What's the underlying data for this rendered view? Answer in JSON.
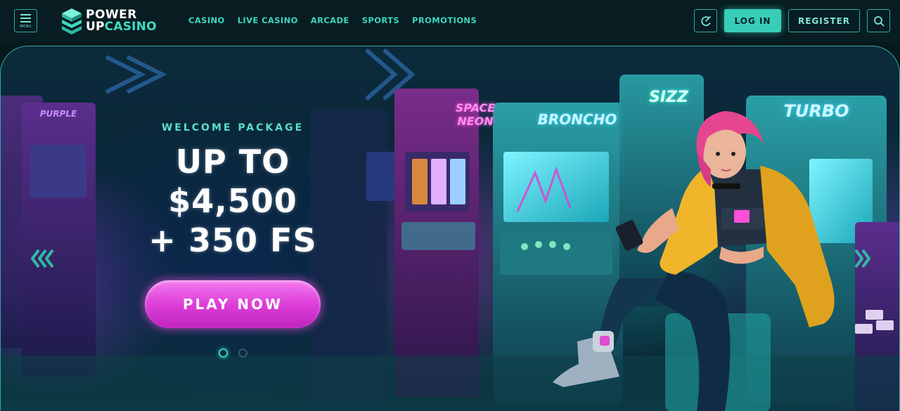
{
  "header": {
    "menu_label": "MENU",
    "logo": {
      "line1": "POWER",
      "line2a": "UP",
      "line2b": "CASINO"
    },
    "nav": [
      "CASINO",
      "LIVE CASINO",
      "ARCADE",
      "SPORTS",
      "PROMOTIONS"
    ],
    "login": "LOG IN",
    "register": "REGISTER"
  },
  "hero": {
    "kicker": "WELCOME PACKAGE",
    "title_line1": "UP TO",
    "title_line2": "$4,500",
    "title_line3": "+ 350 FS",
    "cta": "PLAY NOW",
    "marquees": [
      "SPACE NEON",
      "BRONCHO",
      "SIZZ",
      "TURBO"
    ],
    "slide_count": 2,
    "active_slide": 1
  },
  "colors": {
    "accent": "#37cdb6",
    "nav_text": "#3ed4be",
    "cta": "#dd3fd8",
    "background": "#06191c"
  },
  "icons": [
    "menu-icon",
    "logo-icon",
    "payment-icon",
    "search-icon",
    "chevron-left-icon",
    "chevron-right-icon"
  ]
}
